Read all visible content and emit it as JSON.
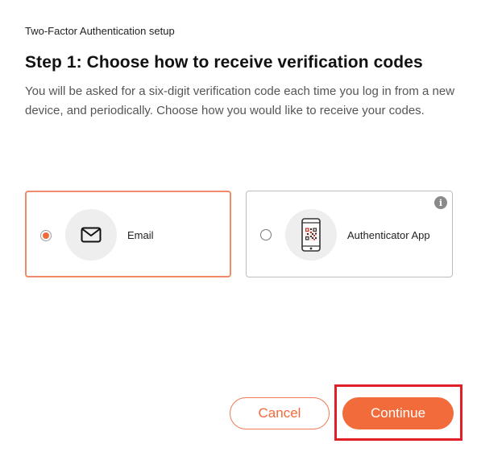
{
  "header": {
    "label": "Two-Factor Authentication setup"
  },
  "step": {
    "title": "Step 1: Choose how to receive verification codes",
    "description": "You will be asked for a six-digit verification code each time you log in from a new device, and periodically. Choose how you would like to receive your codes."
  },
  "options": [
    {
      "label": "Email",
      "icon": "envelope-icon",
      "selected": true
    },
    {
      "label": "Authenticator App",
      "icon": "phone-qr-icon",
      "selected": false,
      "info_icon": "info-icon"
    }
  ],
  "actions": {
    "cancel_label": "Cancel",
    "continue_label": "Continue"
  },
  "colors": {
    "accent": "#f26b3a",
    "selected_border": "#f08a6a",
    "highlight": "#e01f26"
  }
}
